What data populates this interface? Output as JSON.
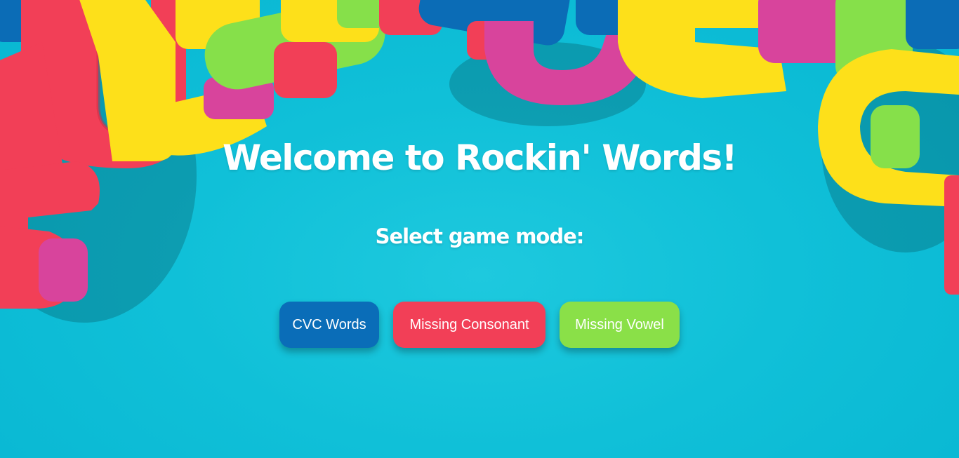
{
  "page": {
    "title": "Welcome to Rockin' Words!",
    "subtitle": "Select game mode:"
  },
  "modes": [
    {
      "label": "CVC Words",
      "color": "#0a6db8"
    },
    {
      "label": "Missing Consonant",
      "color": "#f23f57"
    },
    {
      "label": "Missing Vowel",
      "color": "#8ae048"
    }
  ],
  "colors": {
    "background": "#0fbfd7",
    "letter_red": "#f23f57",
    "letter_yellow": "#fde01a",
    "letter_green": "#86e04a",
    "letter_blue": "#0b6cb6",
    "letter_magenta": "#d8449c"
  }
}
